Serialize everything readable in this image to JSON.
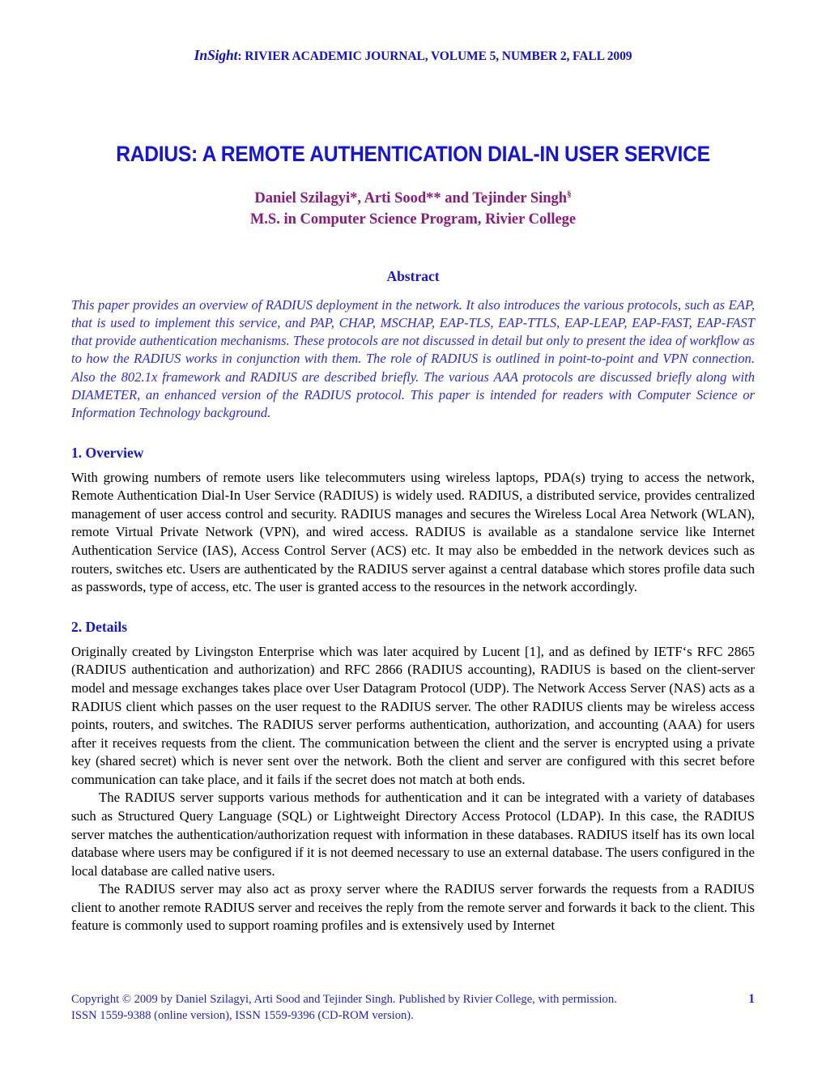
{
  "running_head": {
    "journal_name": "InSight",
    "rest": ": RIVIER ACADEMIC JOURNAL, VOLUME 5, NUMBER 2, FALL 2009"
  },
  "title": "RADIUS: A REMOTE AUTHENTICATION DIAL-IN USER SERVICE",
  "authors": {
    "line1": "Daniel Szilagyi*, Arti Sood** and Tejinder Singh",
    "line1_superscript": "§",
    "line2": "M.S. in Computer Science Program, Rivier College"
  },
  "abstract": {
    "heading": "Abstract",
    "body": "This paper provides an overview of RADIUS deployment in the network. It also introduces the various protocols, such as EAP, that is used to implement this service, and PAP, CHAP, MSCHAP, EAP-TLS, EAP-TTLS, EAP-LEAP, EAP-FAST, EAP-FAST that provide authentication mechanisms. These protocols are not discussed in detail but only to present the idea of workflow as to how the RADIUS works in conjunction with them. The role of RADIUS is outlined in point-to-point and VPN connection. Also the 802.1x framework and RADIUS are described briefly. The various AAA protocols are discussed briefly along with DIAMETER, an enhanced version of the RADIUS protocol. This paper is intended for readers with Computer Science or Information Technology background."
  },
  "sections": [
    {
      "heading": "1. Overview",
      "paragraphs": [
        "With growing numbers of remote users like telecommuters using wireless laptops, PDA(s) trying to access the network, Remote Authentication Dial-In User Service (RADIUS) is widely used. RADIUS, a distributed service, provides centralized management of user access control and security. RADIUS manages and secures the Wireless Local Area Network (WLAN), remote Virtual Private Network (VPN), and wired access. RADIUS is available as a standalone service like Internet Authentication Service (IAS), Access Control Server (ACS) etc. It may also be embedded in the network devices such as routers, switches etc. Users are authenticated by the RADIUS server against a central database which stores profile data such as passwords, type of access, etc. The user is granted access to the resources in the network accordingly."
      ]
    },
    {
      "heading": "2. Details",
      "paragraphs": [
        "Originally created by Livingston Enterprise which was later acquired by Lucent [1], and as defined by IETF‘s RFC 2865 (RADIUS authentication and authorization) and RFC 2866 (RADIUS accounting), RADIUS is based on the client-server model and message exchanges takes place over User Datagram Protocol (UDP). The Network Access Server (NAS) acts as a RADIUS client which passes on the user request to the RADIUS server. The other RADIUS clients may be wireless access points, routers, and switches. The RADIUS server performs authentication, authorization, and accounting (AAA) for users after it receives requests from the client. The communication between the client and the server is encrypted using a private key (shared secret) which is never sent over the network. Both the client and server are configured with this secret before communication can take place, and it fails if the secret does not match at both ends.",
        "The RADIUS server supports various methods for authentication and it can be integrated with a variety of databases such as Structured Query Language (SQL) or Lightweight Directory Access Protocol (LDAP). In this case, the RADIUS server matches the authentication/authorization request with information in these databases. RADIUS itself has its own local database where users may be configured if it is not deemed necessary to use an external database. The users configured in the local database are called native users.",
        "The RADIUS server may also act as proxy server where the RADIUS server forwards the requests from a RADIUS client to another remote RADIUS server and receives the reply from the remote server and forwards it back to the client.  This feature is commonly used to support roaming profiles and is extensively used by Internet"
      ]
    }
  ],
  "footer": {
    "copyright": "Copyright © 2009 by Daniel Szilagyi, Arti Sood and Tejinder Singh. Published by Rivier College, with permission.",
    "issn": "ISSN 1559-9388 (online version), ISSN 1559-9396 (CD-ROM version).",
    "page_number": "1"
  },
  "colors": {
    "heading_blue": "#1414e0",
    "abstract_blue": "#2a2ae8",
    "author_purple": "#8b1a7a",
    "footer_blue": "#1e1ed2",
    "body_black": "#000000"
  }
}
